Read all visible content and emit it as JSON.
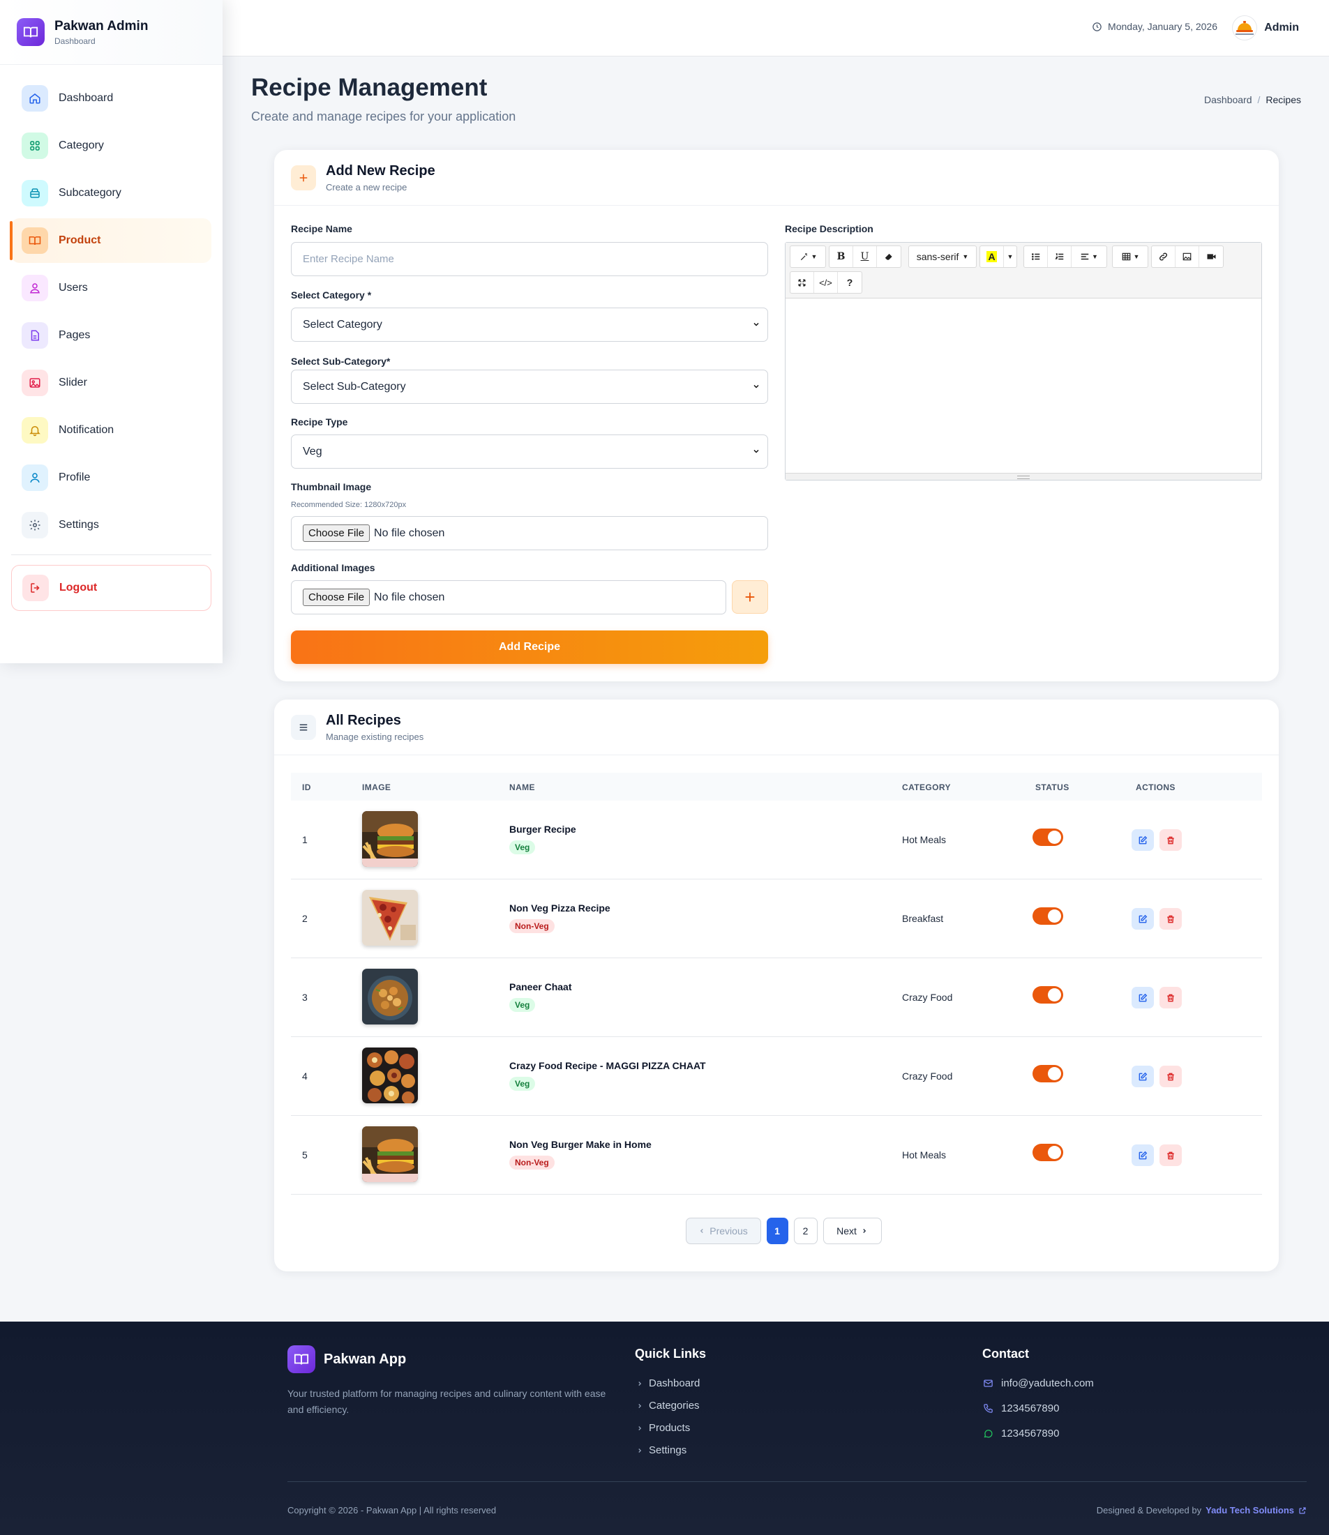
{
  "brand": {
    "title": "Pakwan Admin",
    "subtitle": "Dashboard",
    "icon": "book-open-icon",
    "color": "#7c3aed"
  },
  "sidebar": {
    "items": [
      {
        "label": "Dashboard",
        "icon": "home-icon",
        "color": "#2563eb",
        "bg": "#dbeafe"
      },
      {
        "label": "Category",
        "icon": "grid-icon",
        "color": "#059669",
        "bg": "#d1fae5"
      },
      {
        "label": "Subcategory",
        "icon": "layers-icon",
        "color": "#0891b2",
        "bg": "#cffafe"
      },
      {
        "label": "Product",
        "icon": "book-icon",
        "color": "#ea580c",
        "bg": "#fed7aa",
        "active": true
      },
      {
        "label": "Users",
        "icon": "users-icon",
        "color": "#c026d3",
        "bg": "#fae8ff"
      },
      {
        "label": "Pages",
        "icon": "file-icon",
        "color": "#7c3aed",
        "bg": "#ede9fe"
      },
      {
        "label": "Slider",
        "icon": "image-icon",
        "color": "#e11d48",
        "bg": "#ffe4e6"
      },
      {
        "label": "Notification",
        "icon": "bell-icon",
        "color": "#ca8a04",
        "bg": "#fef9c3"
      },
      {
        "label": "Profile",
        "icon": "user-icon",
        "color": "#0284c7",
        "bg": "#e0f2fe"
      },
      {
        "label": "Settings",
        "icon": "gear-icon",
        "color": "#475569",
        "bg": "#f1f5f9"
      }
    ],
    "logout": "Logout"
  },
  "header": {
    "date": "Monday, January 5, 2026",
    "user": "Admin"
  },
  "page": {
    "title": "Recipe Management",
    "subtitle": "Create and manage recipes for your application",
    "breadcrumb": {
      "home": "Dashboard",
      "sep": "/",
      "current": "Recipes"
    }
  },
  "form": {
    "title": "Add New Recipe",
    "subtitle": "Create a new recipe",
    "name_label": "Recipe Name",
    "name_placeholder": "Enter Recipe Name",
    "category_label": "Select Category *",
    "category_value": "Select Category",
    "subcategory_label": "Select Sub-Category*",
    "subcategory_value": "Select Sub-Category",
    "type_label": "Recipe Type",
    "type_value": "Veg",
    "thumb_label": "Thumbnail Image",
    "thumb_hint": "Recommended Size: 1280x720px",
    "file_button": "Choose File",
    "file_status": "No file chosen",
    "additional_label": "Additional Images",
    "plus": "+",
    "submit": "Add Recipe",
    "description_label": "Recipe Description",
    "editor": {
      "font": "sans-serif",
      "bold": "B",
      "underline": "U",
      "code": "</>",
      "help": "?",
      "color_letter": "A"
    }
  },
  "table": {
    "title": "All Recipes",
    "subtitle": "Manage existing recipes",
    "columns": [
      "ID",
      "IMAGE",
      "NAME",
      "CATEGORY",
      "STATUS",
      "ACTIONS"
    ],
    "rows": [
      {
        "id": "1",
        "name": "Burger Recipe",
        "type": "Veg",
        "category": "Hot Meals",
        "image": "burger",
        "status": true
      },
      {
        "id": "2",
        "name": "Non Veg Pizza Recipe",
        "type": "Non-Veg",
        "category": "Breakfast",
        "image": "pizza",
        "status": true
      },
      {
        "id": "3",
        "name": "Paneer Chaat",
        "type": "Veg",
        "category": "Crazy Food",
        "image": "chaat",
        "status": true
      },
      {
        "id": "4",
        "name": "Crazy Food Recipe - MAGGI PIZZA CHAAT",
        "type": "Veg",
        "category": "Crazy Food",
        "image": "maggi",
        "status": true
      },
      {
        "id": "5",
        "name": "Non Veg Burger Make in Home",
        "type": "Non-Veg",
        "category": "Hot Meals",
        "image": "burger",
        "status": true
      }
    ],
    "pagination": {
      "previous": "Previous",
      "pages": [
        "1",
        "2"
      ],
      "current": "1",
      "next": "Next"
    }
  },
  "footer": {
    "app_name": "Pakwan App",
    "description": "Your trusted platform for managing recipes and culinary content with ease and efficiency.",
    "quick_links_title": "Quick Links",
    "quick_links": [
      "Dashboard",
      "Categories",
      "Products",
      "Settings"
    ],
    "contact_title": "Contact",
    "email": "info@yadutech.com",
    "phone": "1234567890",
    "whatsapp": "1234567890",
    "copyright": "Copyright © 2026 - Pakwan App | All rights reserved",
    "credit_prefix": "Designed & Developed by",
    "credit_company": "Yadu Tech Solutions"
  }
}
